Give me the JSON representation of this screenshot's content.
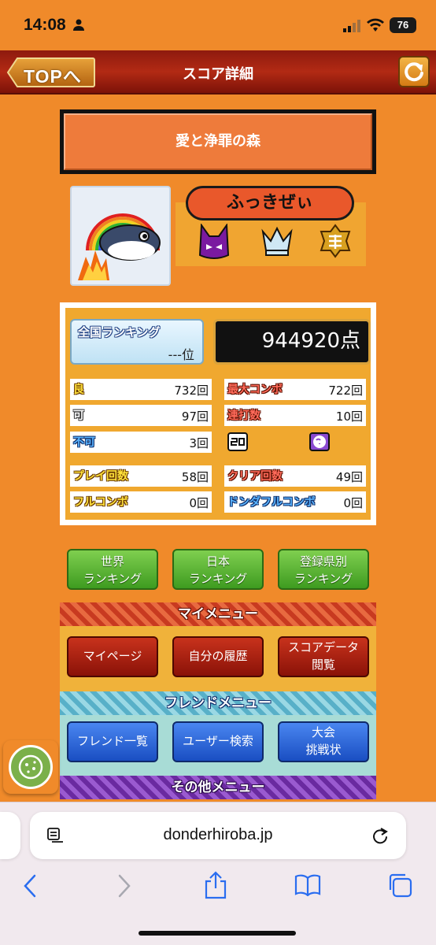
{
  "status": {
    "time": "14:08",
    "battery": "76"
  },
  "header": {
    "back_label": "TOPへ",
    "title": "スコア詳細"
  },
  "song": {
    "title": "愛と浄罪の森"
  },
  "player": {
    "name": "ふっきぜぃ"
  },
  "ranking": {
    "label": "全国ランキング",
    "value": "---位"
  },
  "score": {
    "value": "944920点"
  },
  "stats": {
    "ryo": {
      "label": "良",
      "value": "732回"
    },
    "max_combo": {
      "label": "最大コンボ",
      "value": "722回"
    },
    "ka": {
      "label": "可",
      "value": "97回"
    },
    "renda": {
      "label": "連打数",
      "value": "10回"
    },
    "fuka": {
      "label": "不可",
      "value": "3回"
    },
    "play_count": {
      "label": "プレイ回数",
      "value": "58回"
    },
    "clear_count": {
      "label": "クリア回数",
      "value": "49回"
    },
    "full_combo": {
      "label": "フルコンボ",
      "value": "0回"
    },
    "donda_full_combo": {
      "label": "ドンダフルコンボ",
      "value": "0回"
    }
  },
  "ranking_buttons": [
    {
      "label": "世界\nランキング"
    },
    {
      "label": "日本\nランキング"
    },
    {
      "label": "登録県別\nランキング"
    }
  ],
  "my_menu": {
    "title": "マイメニュー",
    "items": [
      {
        "label": "マイページ"
      },
      {
        "label": "自分の履歴"
      },
      {
        "label": "スコアデータ\n閲覧"
      }
    ]
  },
  "friend_menu": {
    "title": "フレンドメニュー",
    "items": [
      {
        "label": "フレンド一覧"
      },
      {
        "label": "ユーザー検索"
      },
      {
        "label": "大会\n挑戦状"
      }
    ]
  },
  "other_menu": {
    "title": "その他メニュー"
  },
  "browser": {
    "url": "donderhiroba.jp"
  },
  "colors": {
    "page_bg": "#f08a2a",
    "header_red": "#b22a14",
    "score_panel": "#f0a82f"
  },
  "icons": [
    "person-icon",
    "signal-icon",
    "wifi-icon",
    "refresh-icon",
    "devil-mask-icon",
    "crown-icon",
    "miyabi-rank-icon",
    "cookie-icon",
    "reader-icon",
    "reload-icon",
    "back-icon",
    "forward-icon",
    "share-icon",
    "bookmarks-icon",
    "tabs-icon"
  ]
}
